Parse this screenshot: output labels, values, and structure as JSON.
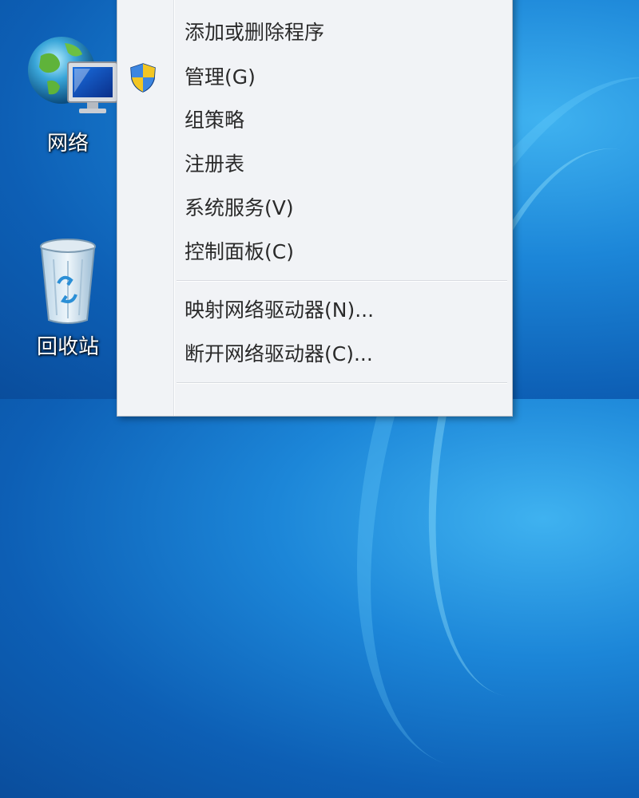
{
  "desktop": {
    "icons": [
      {
        "label": "网络",
        "icon": "network-icon"
      },
      {
        "label": "回收站",
        "icon": "recycle-bin-icon"
      }
    ]
  },
  "context_menu": {
    "items": [
      {
        "label": "添加或删除程序"
      },
      {
        "label": "管理(G)",
        "icon": "uac-shield-icon"
      },
      {
        "label": "组策略"
      },
      {
        "label": "注册表"
      },
      {
        "label": "系统服务(V)"
      },
      {
        "label": "控制面板(C)"
      },
      {
        "label": "映射网络驱动器(N)..."
      },
      {
        "label": "断开网络驱动器(C)..."
      }
    ]
  },
  "colors": {
    "desktop_blue": "#1c86d8",
    "menu_bg": "#f1f3f6",
    "menu_text": "#2a2a2a"
  }
}
